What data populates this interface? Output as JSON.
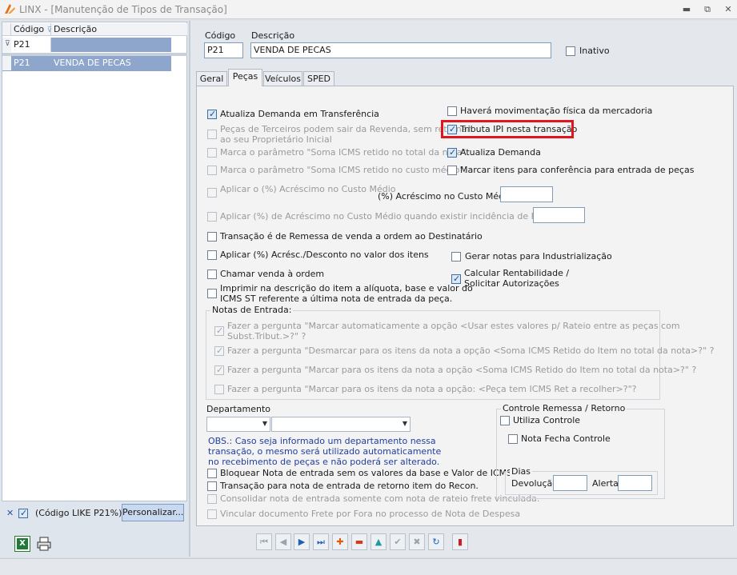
{
  "window": {
    "title": "LINX - [Manutenção de Tipos de Transação]",
    "controls": {
      "minimize": "▬",
      "restore": "⧉",
      "close": "✕"
    }
  },
  "grid": {
    "headers": [
      "Código",
      "Descrição"
    ],
    "filter_row": {
      "codigo": "P21",
      "descricao": ""
    },
    "rows": [
      {
        "codigo": "P21",
        "descricao": "VENDA DE PECAS"
      }
    ]
  },
  "filterbar": {
    "close_glyph": "✕",
    "filter_text": "(Código LIKE P21%)",
    "customize_label": "Personalizar..."
  },
  "form": {
    "codigo_label": "Código",
    "codigo_value": "P21",
    "descricao_label": "Descrição",
    "descricao_value": "VENDA DE PECAS",
    "inativo_label": "Inativo"
  },
  "tabs": [
    "Geral",
    "Peças",
    "Veículos",
    "SPED"
  ],
  "active_tab": "Peças",
  "pecas": {
    "left_options": [
      {
        "label": "Atualiza Demanda em Transferência",
        "checked": true,
        "enabled": true
      },
      {
        "label": "Peças de Terceiros podem sair da Revenda, sem retornar",
        "label2": "ao seu Proprietário Inicial",
        "checked": false,
        "enabled": false
      },
      {
        "label": "Marca o parâmetro \"Soma ICMS retido no total da nota\".",
        "checked": false,
        "enabled": false
      },
      {
        "label": "Marca o parâmetro \"Soma ICMS retido no custo médio\".",
        "checked": false,
        "enabled": false
      },
      {
        "label": "Aplicar o (%) Acréscimo no Custo Médio",
        "checked": false,
        "enabled": false
      },
      {
        "label": "Aplicar (%) de Acréscimo no Custo Médio quando existir incidência de Pis/Cofins:",
        "checked": false,
        "enabled": false
      },
      {
        "label": "Transação é de Remessa de venda a ordem ao Destinatário",
        "checked": false,
        "enabled": true
      },
      {
        "label": "Aplicar (%) Acrésc./Desconto no valor dos itens",
        "checked": false,
        "enabled": true
      },
      {
        "label": "Chamar venda à ordem",
        "checked": false,
        "enabled": true
      },
      {
        "label": "Imprimir na descrição do item a alíquota, base e valor do",
        "label2": "ICMS ST referente a última nota de entrada da peça.",
        "checked": false,
        "enabled": true
      }
    ],
    "right_options": [
      {
        "label": "Haverá movimentação física da mercadoria",
        "checked": false
      },
      {
        "label": "Tributa IPI nesta transação",
        "checked": true
      },
      {
        "label": "Atualiza Demanda",
        "checked": true
      },
      {
        "label": "Marcar itens para conferência para entrada de peças",
        "checked": false
      },
      {
        "label": "Gerar notas para Industrialização",
        "checked": false
      },
      {
        "label": "Calcular Rentabilidade /",
        "label2": "Solicitar Autorizações",
        "checked": true
      }
    ],
    "acrescimo_label": "(%) Acréscimo no Custo Médio:",
    "notas_title": "Notas de Entrada:",
    "notas_options": [
      {
        "label": "Fazer a pergunta \"Marcar automaticamente a opção <Usar estes valores p/ Rateio entre as peças com",
        "label2": "Subst.Tribut.>?\" ?",
        "checked": true
      },
      {
        "label": "Fazer a pergunta \"Desmarcar para os itens da nota a opção <Soma ICMS Retido do Item no total da nota>?\" ?",
        "checked": true
      },
      {
        "label": "Fazer a pergunta \"Marcar para os itens da nota a opção <Soma ICMS Retido do Item no total da nota>?\" ?",
        "checked": true
      },
      {
        "label": "Fazer a pergunta \"Marcar para os itens da nota a opção: <Peça tem ICMS Ret a recolher>?\"?",
        "checked": false
      }
    ],
    "departamento_label": "Departamento",
    "obs_lines": [
      "OBS.: Caso seja informado um departamento nessa",
      "transação, o mesmo será utilizado automaticamente",
      "no recebimento de peças e não poderá ser alterado."
    ],
    "bottom_options": [
      {
        "label": "Bloquear Nota de entrada sem os valores da base e Valor de ICMS ST.",
        "checked": false,
        "enabled": true
      },
      {
        "label": "Transação para nota de entrada de retorno item do Recon.",
        "checked": false,
        "enabled": true
      },
      {
        "label": "Consolidar nota de entrada somente com nota de rateio frete vinculada.",
        "checked": false,
        "enabled": false
      },
      {
        "label": "Vincular documento Frete por Fora no processo de Nota de Despesa",
        "checked": false,
        "enabled": false
      }
    ],
    "controle": {
      "title": "Controle Remessa / Retorno",
      "utiliza_label": "Utiliza Controle",
      "nota_fecha_label": "Nota Fecha Controle",
      "dias_title": "Dias",
      "devolucao_label": "Devolução",
      "alerta_label": "Alerta"
    }
  },
  "navigator": {
    "buttons": [
      {
        "name": "first-record-button",
        "glyph": "⏮",
        "color": "#9aa4ae"
      },
      {
        "name": "prior-record-button",
        "glyph": "◀",
        "color": "#9aa4ae"
      },
      {
        "name": "next-record-button",
        "glyph": "▶",
        "color": "#1f5fb4"
      },
      {
        "name": "last-record-button",
        "glyph": "⏭",
        "color": "#1f5fb4"
      },
      {
        "name": "insert-button",
        "glyph": "✚",
        "color": "#e05a10"
      },
      {
        "name": "delete-button",
        "glyph": "▬",
        "color": "#d23a20"
      },
      {
        "name": "edit-button",
        "glyph": "▲",
        "color": "#1f9aa0"
      },
      {
        "name": "post-button",
        "glyph": "✔",
        "color": "#9aa4ae"
      },
      {
        "name": "cancel-button",
        "glyph": "✖",
        "color": "#9aa4ae"
      },
      {
        "name": "refresh-button",
        "glyph": "↻",
        "color": "#1f5fb4"
      },
      {
        "name": "exit-button",
        "glyph": "▮",
        "color": "#c8202a"
      }
    ]
  },
  "colors": {
    "accent": "#1f5fb4",
    "selection": "#8ea6cc",
    "highlight_box": "#e2141e"
  }
}
